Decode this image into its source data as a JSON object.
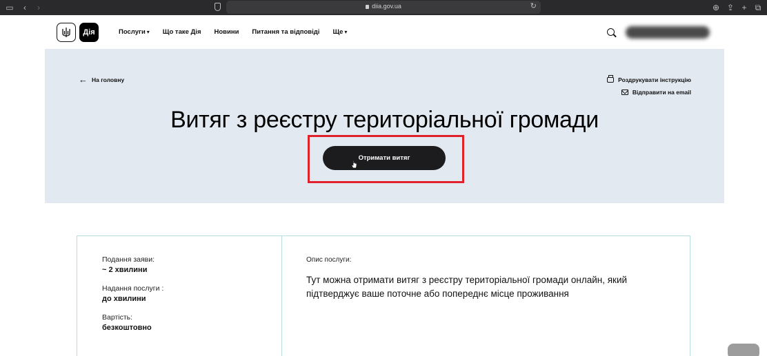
{
  "browser": {
    "url": "diia.gov.ua"
  },
  "header": {
    "logo_text": "Дія",
    "nav": [
      {
        "label": "Послуги",
        "has_dropdown": true
      },
      {
        "label": "Що таке Дія",
        "has_dropdown": false
      },
      {
        "label": "Новини",
        "has_dropdown": false
      },
      {
        "label": "Питання та відповіді",
        "has_dropdown": false
      },
      {
        "label": "Ще",
        "has_dropdown": true
      }
    ]
  },
  "hero": {
    "back_label": "На головну",
    "print_label": "Роздрукувати інструкцію",
    "email_label": "Відправити на email",
    "title": "Витяг з реєстру територіальної громади",
    "cta_label": "Отримати витяг",
    "highlight_color": "#e0202a"
  },
  "info": {
    "application_label": "Подання заяви:",
    "application_value": "~ 2 хвилини",
    "service_label": "Надання послуги :",
    "service_value": "до хвилини",
    "cost_label": "Вартість:",
    "cost_value": "безкоштовно",
    "description_label": "Опис послуги:",
    "description_text": "Тут можна отримати витяг з реєстру територіальної громади онлайн, який підтверджує ваше поточне або попереднє місце проживання"
  },
  "colors": {
    "hero_bg": "#e3e9f1",
    "card_border": "#b6dbe0",
    "cta_bg": "#1c1c1e"
  }
}
